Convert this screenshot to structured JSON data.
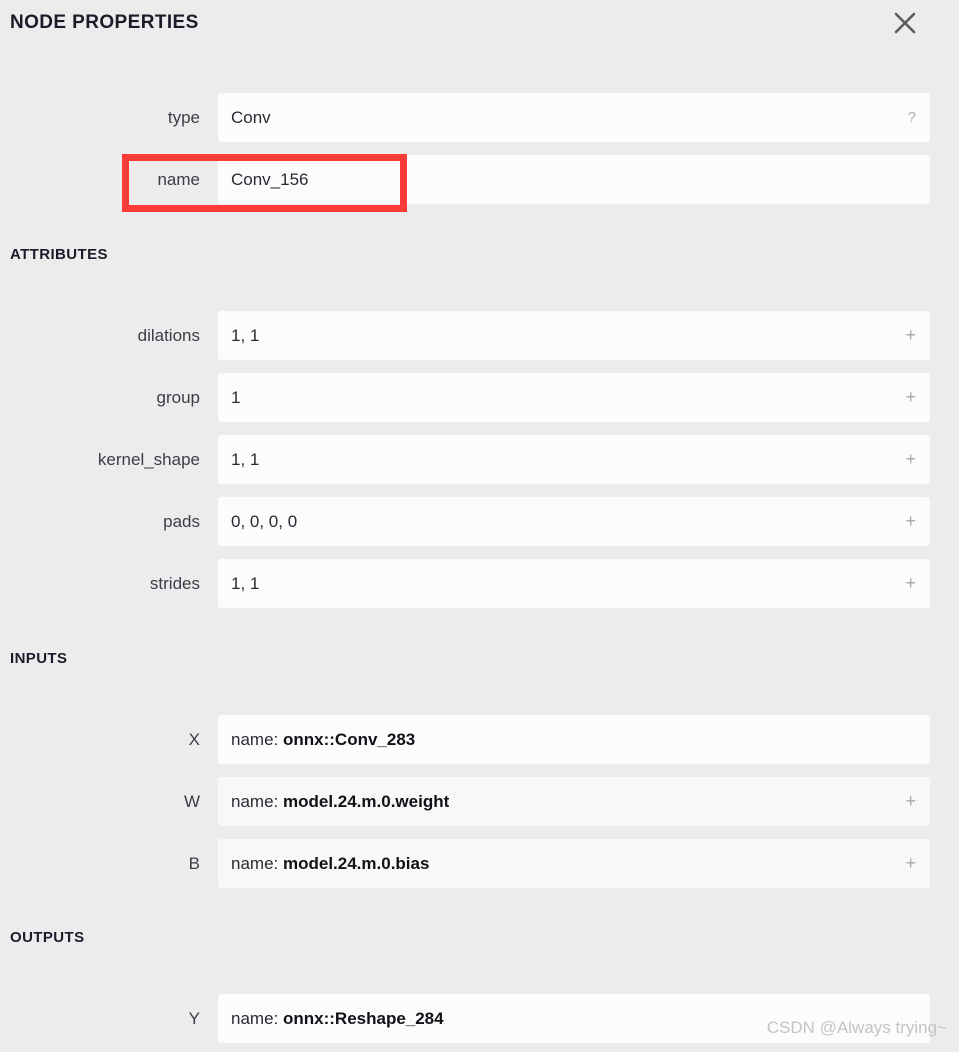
{
  "header": {
    "title": "NODE PROPERTIES",
    "close_icon": "close-icon"
  },
  "node": {
    "rows": [
      {
        "label": "type",
        "value": "Conv",
        "action": "?"
      },
      {
        "label": "name",
        "value": "Conv_156",
        "action": ""
      }
    ]
  },
  "attributes": {
    "heading": "ATTRIBUTES",
    "rows": [
      {
        "label": "dilations",
        "value": "1, 1",
        "action": "+"
      },
      {
        "label": "group",
        "value": "1",
        "action": "+"
      },
      {
        "label": "kernel_shape",
        "value": "1, 1",
        "action": "+"
      },
      {
        "label": "pads",
        "value": "0, 0, 0, 0",
        "action": "+"
      },
      {
        "label": "strides",
        "value": "1, 1",
        "action": "+"
      }
    ]
  },
  "inputs": {
    "heading": "INPUTS",
    "rows": [
      {
        "label": "X",
        "prefix": "name: ",
        "value": "onnx::Conv_283",
        "action": ""
      },
      {
        "label": "W",
        "prefix": "name: ",
        "value": "model.24.m.0.weight",
        "action": "+"
      },
      {
        "label": "B",
        "prefix": "name: ",
        "value": "model.24.m.0.bias",
        "action": "+"
      }
    ]
  },
  "outputs": {
    "heading": "OUTPUTS",
    "rows": [
      {
        "label": "Y",
        "prefix": "name: ",
        "value": "onnx::Reshape_284",
        "action": ""
      }
    ]
  },
  "annotation": {
    "highlight_color": "#fb3b38",
    "highlights": [
      "name-row"
    ]
  },
  "watermark": {
    "text": "CSDN @Always trying~"
  },
  "colors": {
    "background": "#ececec",
    "field": "#fcfcfc",
    "field_shaded": "#f8f8f8",
    "text": "#2a2a34",
    "heading": "#1b1b2a",
    "muted": "#a8a8a8",
    "accent_red": "#fb3b38"
  }
}
